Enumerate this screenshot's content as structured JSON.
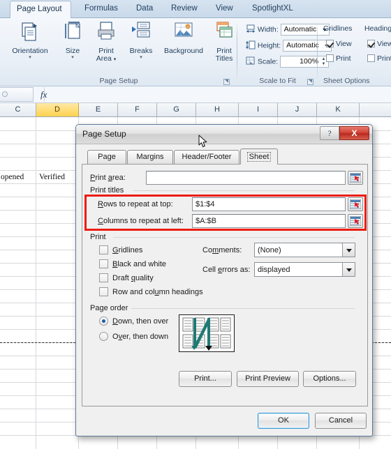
{
  "ribbon": {
    "tabs": [
      {
        "label": "Page Layout",
        "active": true
      },
      {
        "label": "Formulas",
        "active": false
      },
      {
        "label": "Data",
        "active": false
      },
      {
        "label": "Review",
        "active": false
      },
      {
        "label": "View",
        "active": false
      },
      {
        "label": "SpotlightXL",
        "active": false
      }
    ],
    "groups": {
      "page_setup": {
        "label": "Page Setup",
        "buttons": [
          {
            "label": "Orientation",
            "icon": "orientation-icon",
            "dropdown": true
          },
          {
            "label": "Size",
            "icon": "size-icon",
            "dropdown": true
          },
          {
            "label": "Print Area",
            "icon": "print-area-icon",
            "dropdown": true
          },
          {
            "label": "Breaks",
            "icon": "breaks-icon",
            "dropdown": true
          },
          {
            "label": "Background",
            "icon": "background-icon",
            "dropdown": false
          },
          {
            "label": "Print Titles",
            "icon": "print-titles-icon",
            "dropdown": false
          }
        ]
      },
      "scale_to_fit": {
        "label": "Scale to Fit",
        "fields": [
          {
            "label": "Width:",
            "value": "Automatic",
            "icon": "width-icon",
            "control": "combo"
          },
          {
            "label": "Height:",
            "value": "Automatic",
            "icon": "height-icon",
            "control": "combo"
          },
          {
            "label": "Scale:",
            "value": "100%",
            "icon": "scale-icon",
            "control": "spinner"
          }
        ]
      },
      "sheet_options": {
        "label": "Sheet Options",
        "columns": [
          {
            "header": "Gridlines",
            "items": [
              {
                "label": "View",
                "checked": true
              },
              {
                "label": "Print",
                "checked": false
              }
            ]
          },
          {
            "header": "Headings",
            "items": [
              {
                "label": "View",
                "checked": true
              },
              {
                "label": "Print",
                "checked": false
              }
            ]
          }
        ]
      }
    }
  },
  "formula_bar": {
    "name_box_value": "",
    "fx_label": "fx",
    "formula_value": ""
  },
  "sheet": {
    "column_headers": [
      {
        "label": "C",
        "selected": false
      },
      {
        "label": "D",
        "selected": true
      },
      {
        "label": "E",
        "selected": false
      },
      {
        "label": "F",
        "selected": false
      },
      {
        "label": "G",
        "selected": false
      },
      {
        "label": "H",
        "selected": false
      },
      {
        "label": "I",
        "selected": false
      },
      {
        "label": "J",
        "selected": false
      },
      {
        "label": "K",
        "selected": false
      }
    ],
    "cells": [
      {
        "text": "opened"
      },
      {
        "text": "Verified"
      }
    ]
  },
  "dialog": {
    "title": "Page Setup",
    "titlebar": {
      "help_label": "?",
      "close_label": "X"
    },
    "tabs": [
      {
        "label": "Page",
        "active": false
      },
      {
        "label": "Margins",
        "active": false
      },
      {
        "label": "Header/Footer",
        "active": false
      },
      {
        "label": "Sheet",
        "active": true
      }
    ],
    "print_area": {
      "label": "Print area:",
      "value": "",
      "range_button": "collapse-dialog-icon"
    },
    "print_titles": {
      "group_label": "Print titles",
      "highlight_color": "#ee1b11",
      "rows": {
        "label": "Rows to repeat at top:",
        "value": "$1:$4",
        "range_button": "collapse-dialog-icon"
      },
      "columns": {
        "label": "Columns to repeat at left:",
        "value": "$A:$B",
        "range_button": "collapse-dialog-icon"
      }
    },
    "print": {
      "group_label": "Print",
      "checkboxes": [
        {
          "label": "Gridlines",
          "checked": false
        },
        {
          "label": "Black and white",
          "checked": false
        },
        {
          "label": "Draft quality",
          "checked": false
        },
        {
          "label": "Row and column headings",
          "checked": false
        }
      ],
      "selects": [
        {
          "label": "Comments:",
          "value": "(None)"
        },
        {
          "label": "Cell errors as:",
          "value": "displayed"
        }
      ]
    },
    "page_order": {
      "group_label": "Page order",
      "options": [
        {
          "label": "Down, then over",
          "selected": true
        },
        {
          "label": "Over, then down",
          "selected": false
        }
      ],
      "preview_icon": "page-order-preview-icon"
    },
    "action_buttons": [
      {
        "label": "Print...",
        "name": "print-button"
      },
      {
        "label": "Print Preview",
        "name": "print-preview-button"
      },
      {
        "label": "Options...",
        "name": "options-button"
      }
    ],
    "footer_buttons": [
      {
        "label": "OK",
        "name": "ok-button",
        "default": true
      },
      {
        "label": "Cancel",
        "name": "cancel-button",
        "default": false
      }
    ]
  }
}
